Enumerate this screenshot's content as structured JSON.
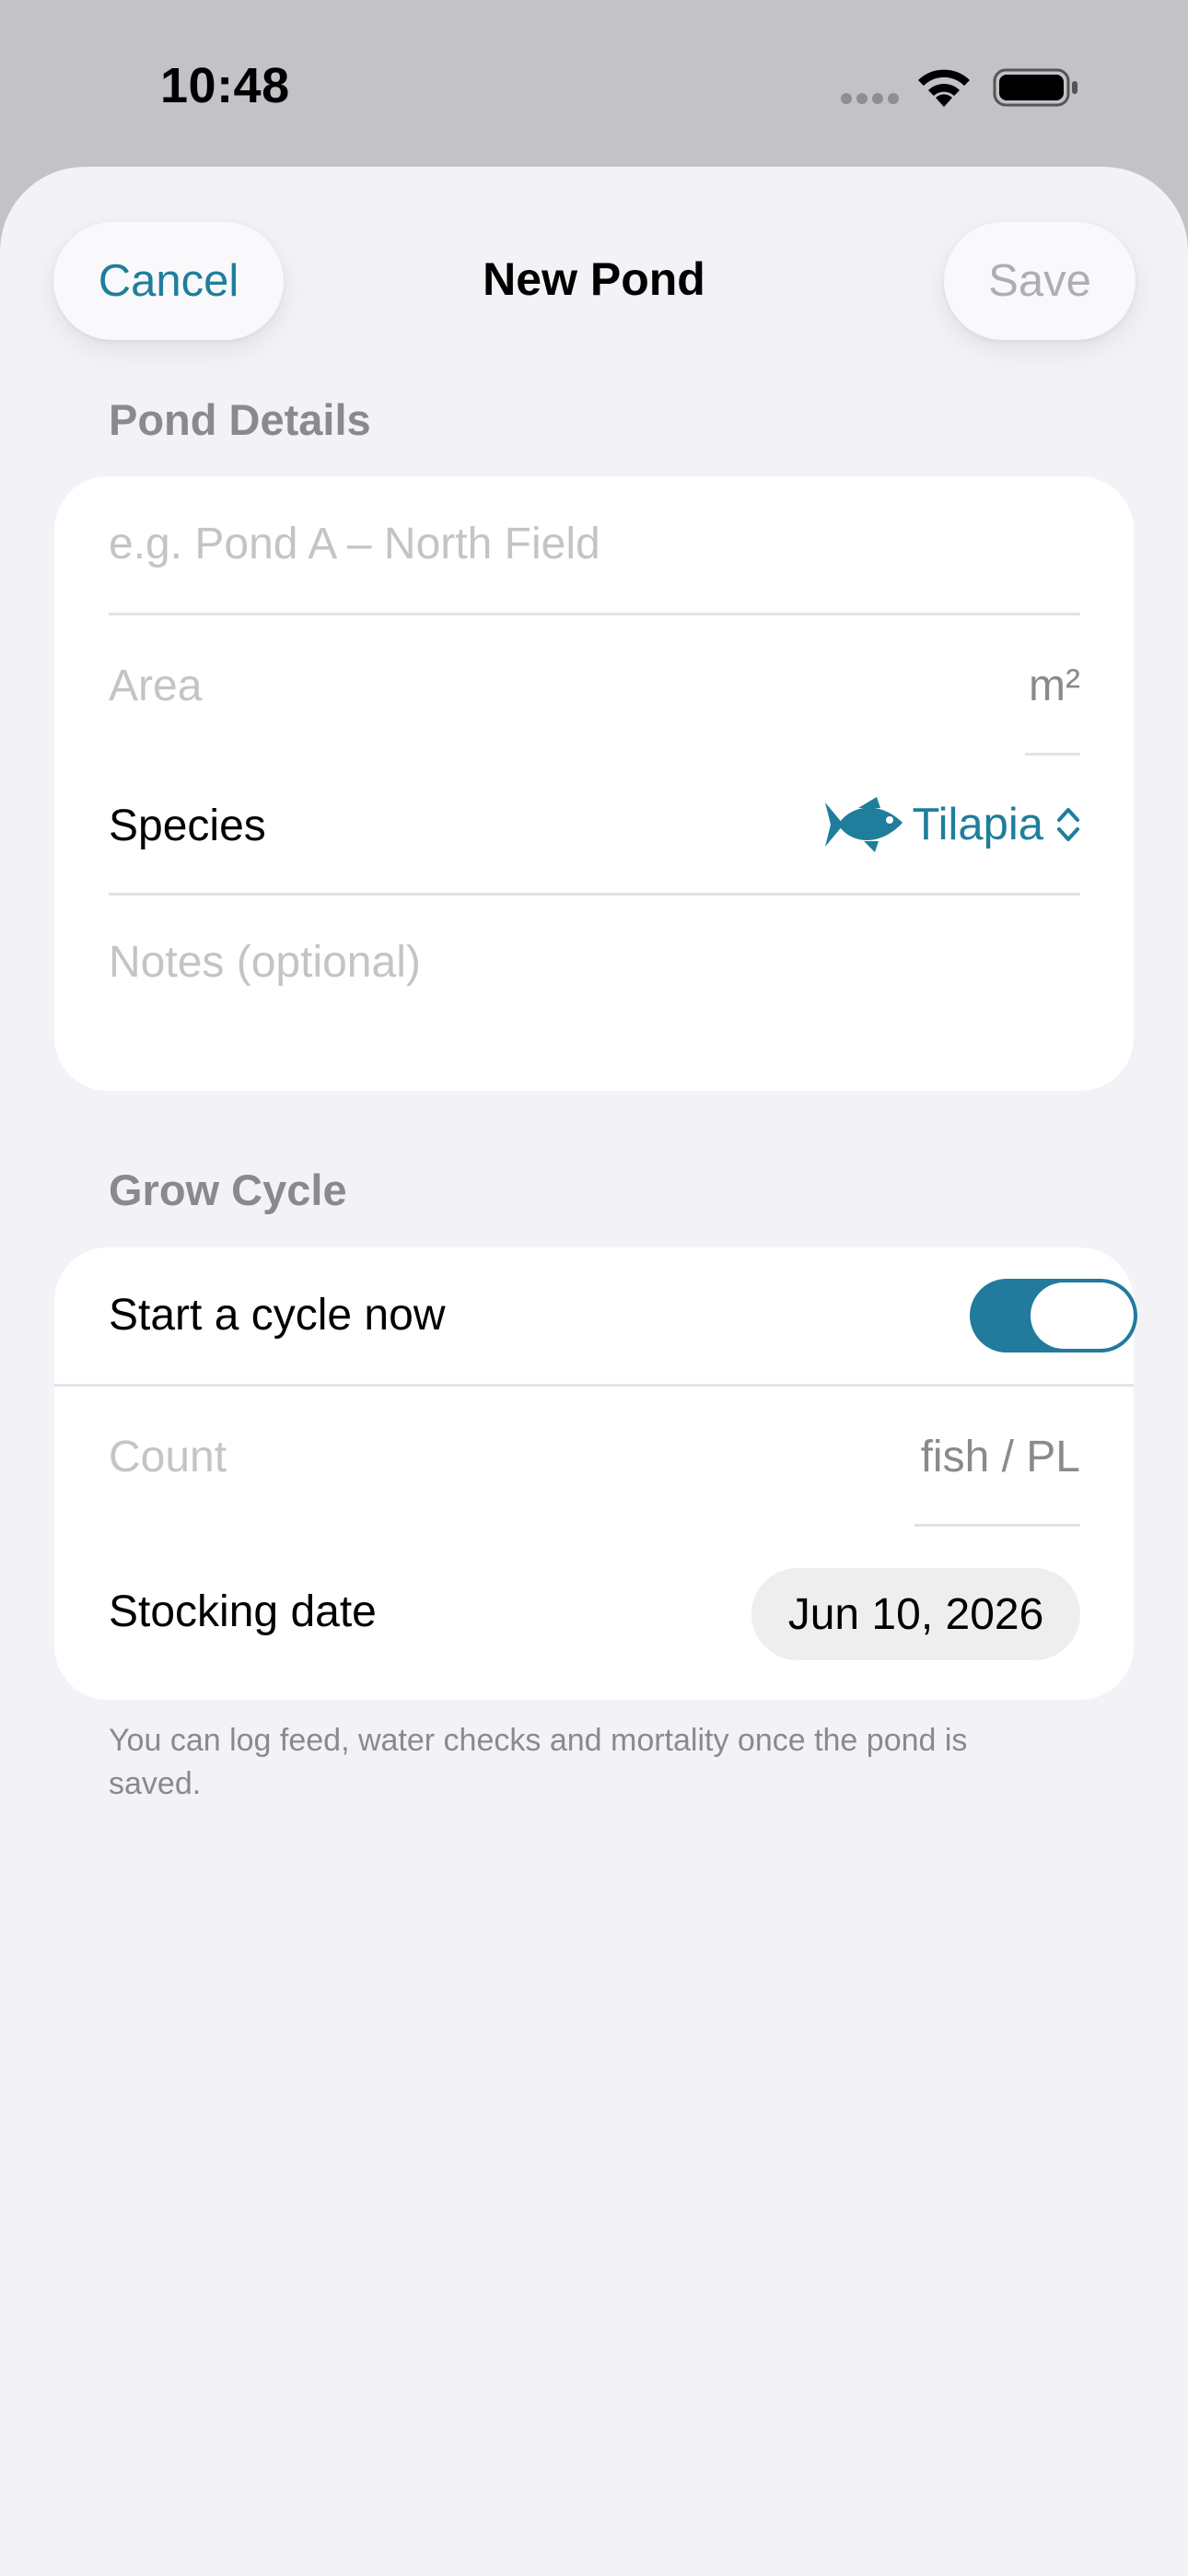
{
  "status_bar": {
    "time": "10:48"
  },
  "nav": {
    "cancel_label": "Cancel",
    "title": "New Pond",
    "save_label": "Save"
  },
  "pond_details": {
    "header": "Pond Details",
    "name_placeholder": "e.g. Pond A – North Field",
    "area_placeholder": "Area",
    "area_unit": "m²",
    "species_label": "Species",
    "species_value": "Tilapia",
    "species_icon": "fish-icon",
    "notes_placeholder": "Notes (optional)"
  },
  "grow_cycle": {
    "header": "Grow Cycle",
    "start_label": "Start a cycle now",
    "start_enabled": true,
    "count_placeholder": "Count",
    "count_unit": "fish / PL",
    "stocking_label": "Stocking date",
    "stocking_value": "Jun 10, 2026"
  },
  "footnote": "You can log feed, water checks and mortality once the pond is saved.",
  "colors": {
    "accent": "#1f7e9b",
    "toggle_on": "#227a9c",
    "background": "#f2f2f7",
    "disabled": "#aeaeb2"
  }
}
